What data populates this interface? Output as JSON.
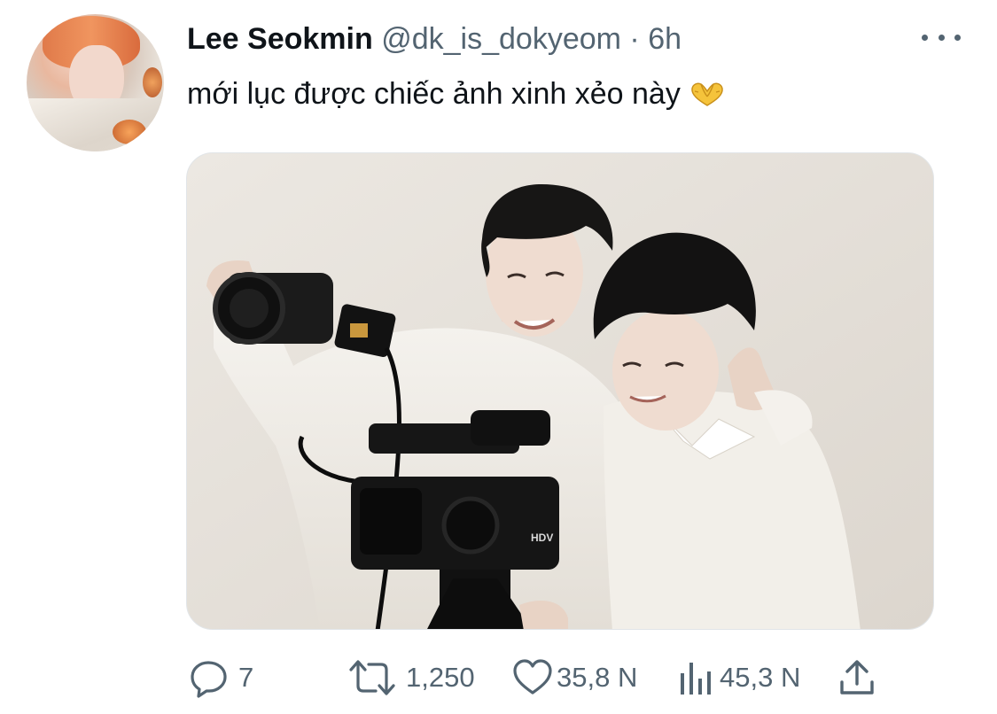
{
  "tweet": {
    "author": {
      "display_name": "Lee Seokmin",
      "handle": "@dk_is_dokyeom",
      "separator": "·",
      "time": "6h"
    },
    "text": "mới lục được chiếc ảnh xinh xẻo này",
    "emoji_icon": "heart-hands-icon",
    "media": {
      "camera_badge": "HDV"
    },
    "actions": {
      "reply_count": "7",
      "retweet_count": "1,250",
      "like_count": "35,8 N",
      "views_count": "45,3 N"
    }
  },
  "colors": {
    "text_primary": "#0f1419",
    "text_secondary": "#536471",
    "background": "#ffffff",
    "emoji": "#f5c33b"
  },
  "icons": [
    "more-icon",
    "reply-icon",
    "retweet-icon",
    "like-icon",
    "views-icon",
    "share-icon"
  ]
}
